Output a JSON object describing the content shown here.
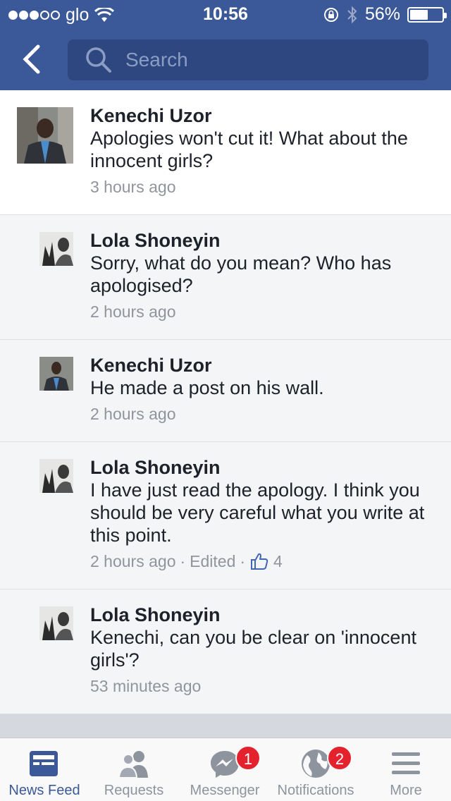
{
  "status_bar": {
    "carrier": "glo",
    "time": "10:56",
    "battery": "56%",
    "battery_level": 0.56
  },
  "header": {
    "search_placeholder": "Search"
  },
  "comments": [
    {
      "author": "Kenechi Uzor",
      "text": "Apologies won't cut it! What about the innocent girls?",
      "time": "3 hours ago"
    },
    {
      "author": "Lola Shoneyin",
      "text": "Sorry, what do you mean? Who has apologised?",
      "time": "2 hours ago"
    },
    {
      "author": "Kenechi Uzor",
      "text": "He made a post on his wall.",
      "time": "2 hours ago"
    },
    {
      "author": "Lola Shoneyin",
      "text": "I have just read the apology. I think you should be very careful what you write at this point.",
      "time": "2 hours ago",
      "edited": "Edited",
      "likes": "4"
    },
    {
      "author": "Lola Shoneyin",
      "text": "Kenechi, can you be clear on 'innocent girls'?",
      "time": "53 minutes ago"
    }
  ],
  "tabs": [
    {
      "label": "News Feed",
      "icon": "news-feed-icon"
    },
    {
      "label": "Requests",
      "icon": "friend-requests-icon"
    },
    {
      "label": "Messenger",
      "icon": "messenger-icon",
      "badge": "1"
    },
    {
      "label": "Notifications",
      "icon": "globe-icon",
      "badge": "2"
    },
    {
      "label": "More",
      "icon": "menu-icon"
    }
  ],
  "colors": {
    "brand": "#3b5998",
    "badge": "#e4222e"
  }
}
